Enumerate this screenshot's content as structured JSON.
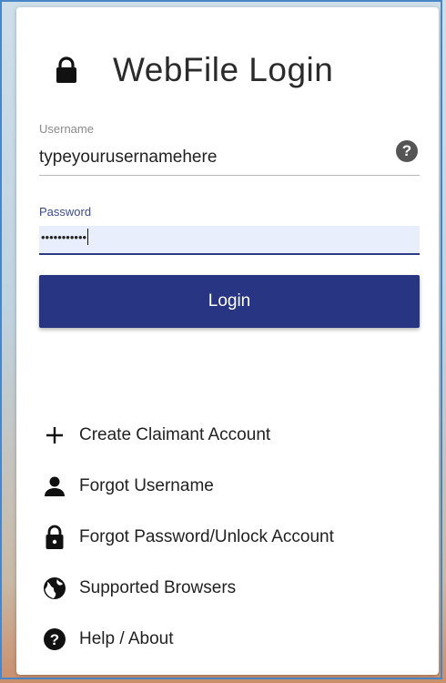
{
  "login": {
    "title": "WebFile Login",
    "username": {
      "label": "Username",
      "value": "typeyourusernamehere"
    },
    "password": {
      "label": "Password",
      "masked_value": "•••••••••••"
    },
    "login_button": "Login"
  },
  "links": [
    {
      "icon": "plus-icon",
      "label": "Create Claimant Account"
    },
    {
      "icon": "person-icon",
      "label": "Forgot Username"
    },
    {
      "icon": "lock-icon",
      "label": "Forgot Password/Unlock Account"
    },
    {
      "icon": "globe-icon",
      "label": "Supported Browsers"
    },
    {
      "icon": "question-icon",
      "label": "Help / About"
    }
  ],
  "colors": {
    "primary": "#283582",
    "input_focus_bg": "#e8eefb",
    "frame_border": "#4a86c5"
  }
}
